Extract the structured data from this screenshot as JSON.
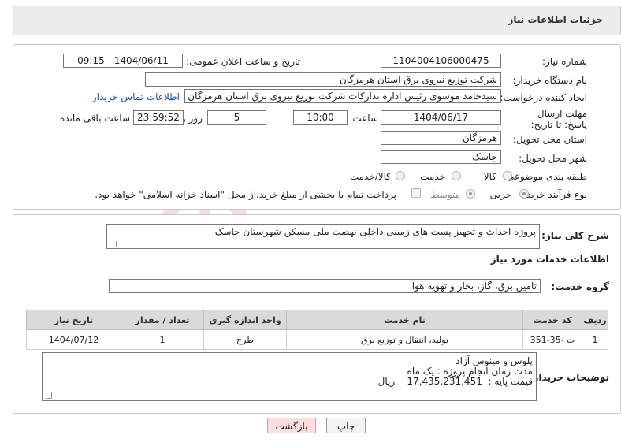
{
  "title": "جزئیات اطلاعات نیاز",
  "fields": {
    "need_number_label": "شماره نیاز:",
    "need_number": "1104004106000475",
    "announce_label": "تاریخ و ساعت اعلان عمومی:",
    "announce_value": "1404/06/11 - 09:15",
    "buyer_label": "نام دستگاه خریدار:",
    "buyer_value": "شرکت توزیع نیروی برق استان هرمزگان",
    "creator_label": "ایجاد کننده درخواست:",
    "creator_value": "سیدحامد موسوی رئیس اداره تدارکات شرکت توزیع نیروی برق استان هرمزگان",
    "contact_link": "اطلاعات تماس خریدار",
    "deadline_label": "مهلت ارسال پاسخ: تا تاریخ:",
    "deadline_date": "1404/06/17",
    "hour_label": "ساعت",
    "deadline_time": "10:00",
    "days_value": "5",
    "days_label": "روز و",
    "remaining_time": "23:59:52",
    "remaining_label": "ساعت باقی مانده",
    "province_label": "استان محل تحویل:",
    "province_value": "هرمزگان",
    "city_label": "شهر محل تحویل:",
    "city_value": "جاسک",
    "category_label": "طبقه بندی موضوعی:",
    "category_options": [
      "کالا",
      "خدمت",
      "کالا/خدمت"
    ],
    "category_selected": "خدمت",
    "process_label": "نوع فرآیند خرید :",
    "process_options": [
      "جزیی",
      "متوسط"
    ],
    "process_selected": "جزیی",
    "payment_note": "پرداخت تمام یا بخشی از مبلغ خرید،از محل \"اسناد خزانه اسلامی\" خواهد بود."
  },
  "summary": {
    "label": "شرح کلی نیاز:",
    "value": "پروژه احداث و تجهیز پست های زمینی داخلی نهضت ملی مسکن شهرستان جاسک"
  },
  "services": {
    "heading": "اطلاعات خدمات مورد نیاز",
    "group_label": "گروه خدمت:",
    "group_value": "تامین برق، گاز، بخار و تهویه هوا",
    "columns": [
      "ردیف",
      "کد خدمت",
      "نام خدمت",
      "واحد اندازه گیری",
      "تعداد / مقدار",
      "تاریخ نیاز"
    ],
    "rows": [
      [
        "1",
        "ت -35-351",
        "تولید، انتقال و توزیع برق",
        "طرح",
        "1",
        "1404/07/12"
      ]
    ]
  },
  "buyer_notes": {
    "label": "توضیحات خریدار:",
    "lines": [
      "پلوس و مینوس آزاد",
      "مدت زمان انجام پروژه : یک ماه",
      "قیمت پایه :  17,435,231,451    ریال"
    ]
  },
  "buttons": {
    "print": "چاپ",
    "back": "بازگشت"
  },
  "colors": {
    "title_bg": "#ececec",
    "back_button_bg": "#fbdede",
    "link": "#2255aa"
  }
}
